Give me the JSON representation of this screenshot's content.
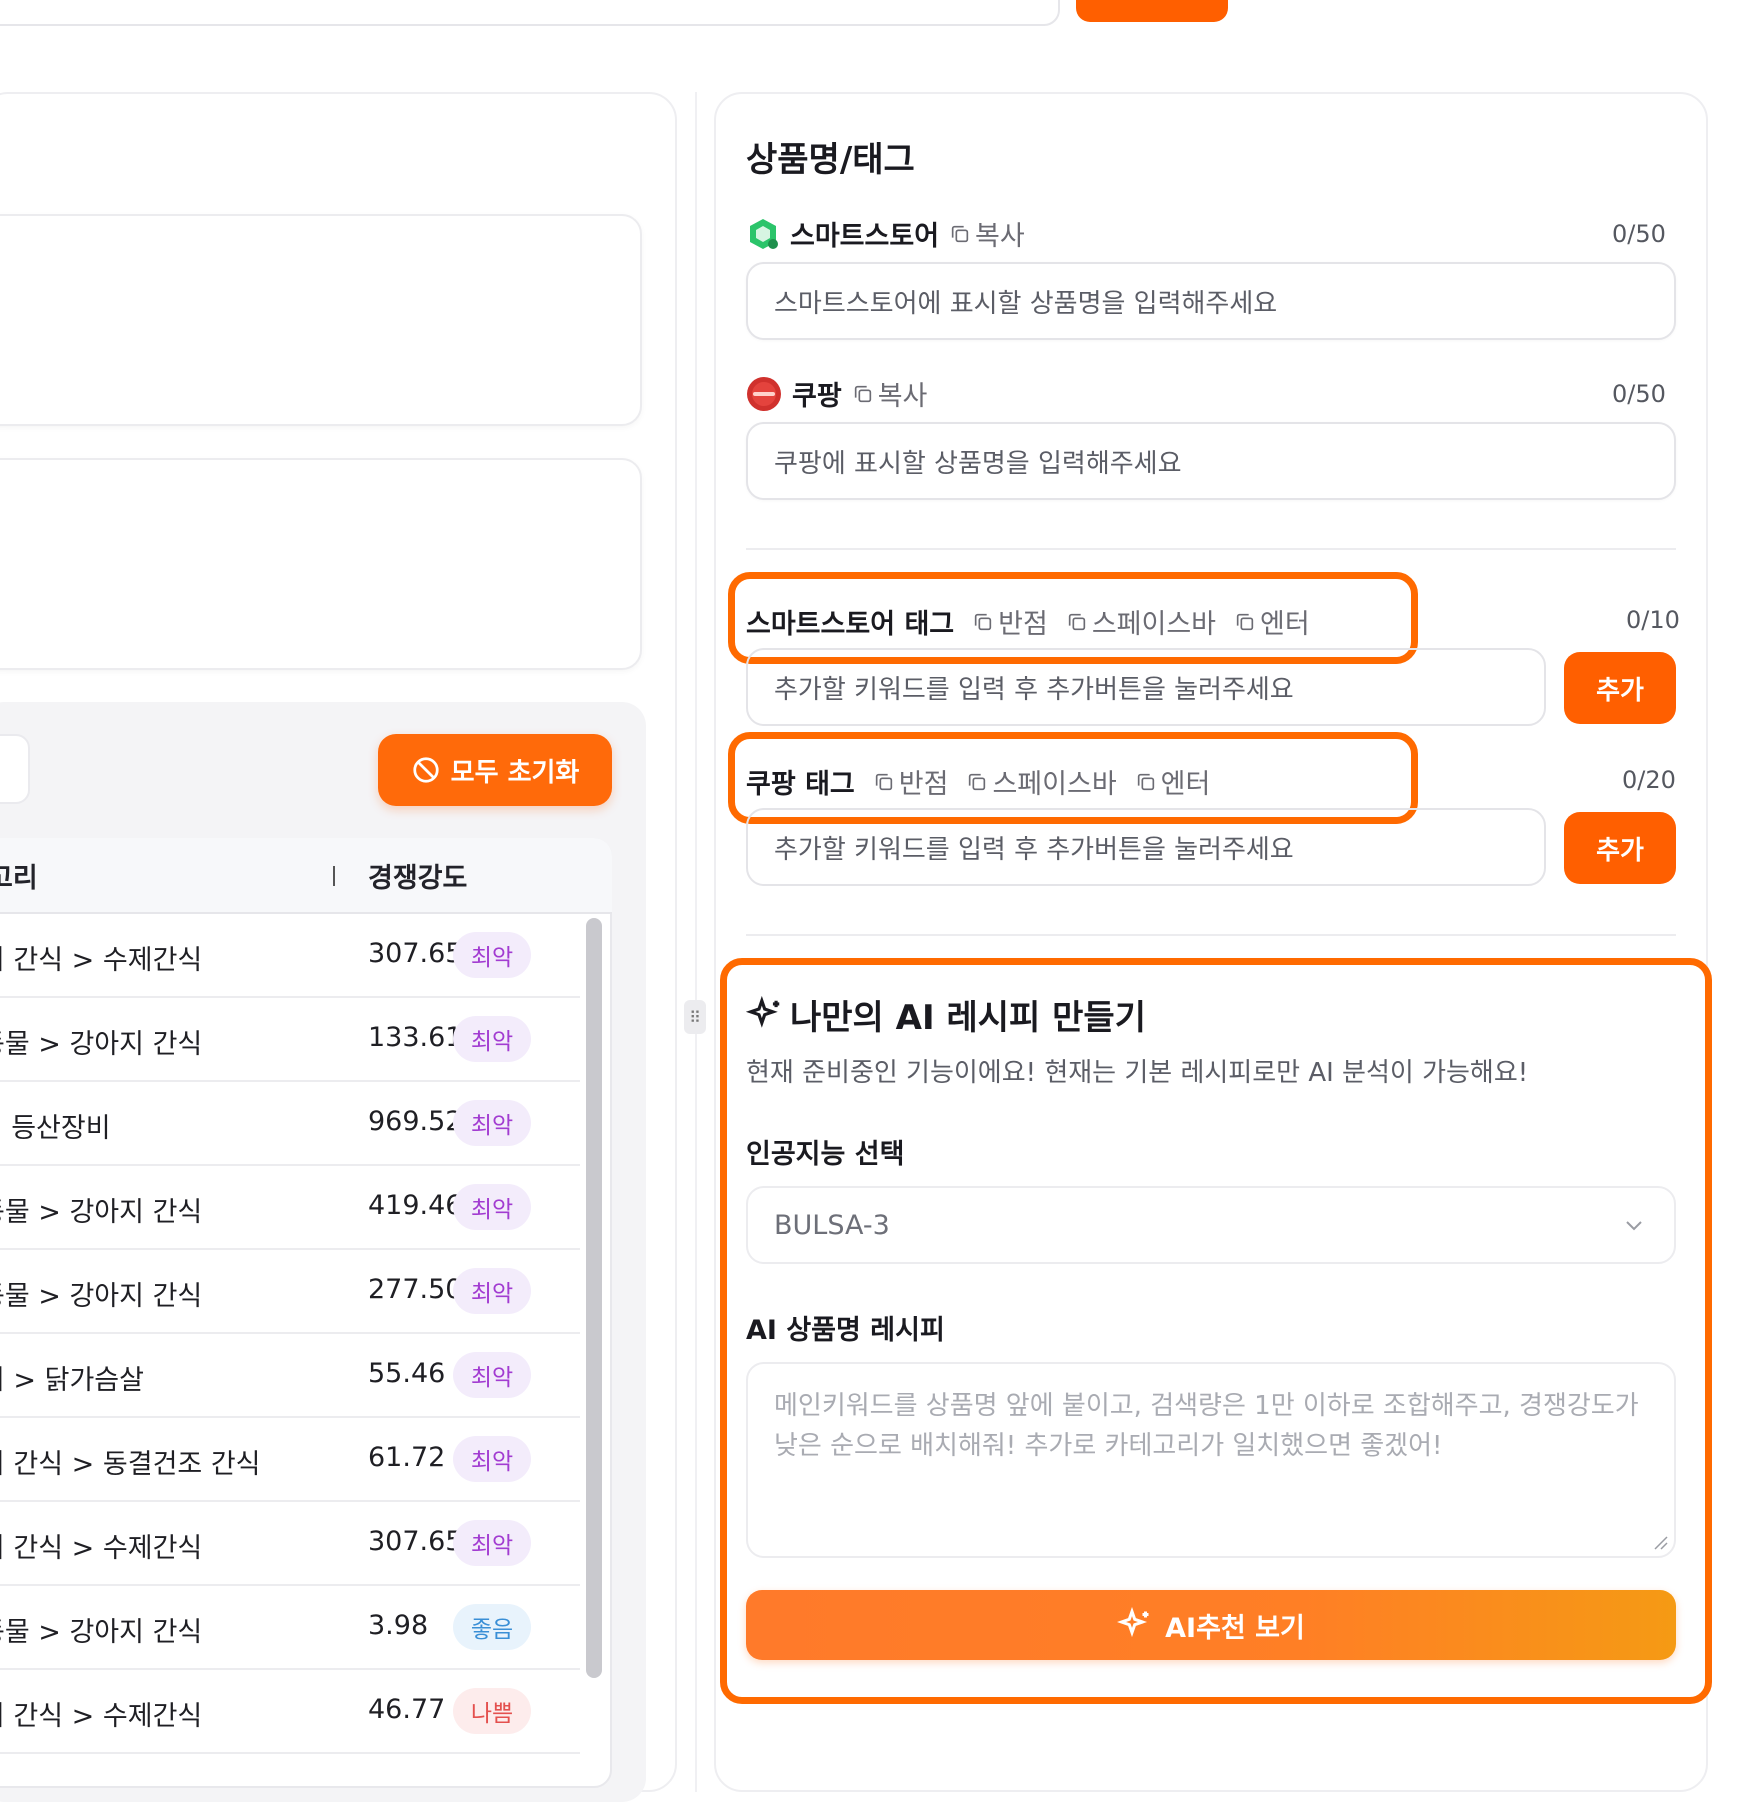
{
  "left": {
    "reset_label": "모두 초기화",
    "table": {
      "headers": {
        "category": "고리",
        "competition": "경쟁강도"
      },
      "rows": [
        {
          "category": "지 간식 > 수제간식",
          "value": "307.65",
          "badge": "최악",
          "badge_type": "bad"
        },
        {
          "category": "동물 > 강아지 간식",
          "value": "133.61",
          "badge": "최악",
          "badge_type": "bad"
        },
        {
          "category": "> 등산장비",
          "value": "969.52",
          "badge": "최악",
          "badge_type": "bad"
        },
        {
          "category": "동물 > 강아지 간식",
          "value": "419.46",
          "badge": "최악",
          "badge_type": "bad"
        },
        {
          "category": "동물 > 강아지 간식",
          "value": "277.50",
          "badge": "최악",
          "badge_type": "bad"
        },
        {
          "category": "기 > 닭가슴살",
          "value": "55.46",
          "badge": "최악",
          "badge_type": "bad"
        },
        {
          "category": "지 간식 > 동결건조 간식",
          "value": "61.72",
          "badge": "최악",
          "badge_type": "bad"
        },
        {
          "category": "지 간식 > 수제간식",
          "value": "307.65",
          "badge": "최악",
          "badge_type": "bad"
        },
        {
          "category": "동물 > 강아지 간식",
          "value": "3.98",
          "badge": "좋음",
          "badge_type": "good"
        },
        {
          "category": "지 간식 > 수제간식",
          "value": "46.77",
          "badge": "나쁨",
          "badge_type": "poor"
        }
      ]
    }
  },
  "right": {
    "section_title": "상품명/태그",
    "smartstore": {
      "name": "스마트스토어",
      "copy": "복사",
      "counter": "0/50",
      "placeholder": "스마트스토어에 표시할 상품명을 입력해주세요"
    },
    "coupang": {
      "name": "쿠팡",
      "copy": "복사",
      "counter": "0/50",
      "placeholder": "쿠팡에 표시할 상품명을 입력해주세요"
    },
    "smartstore_tags": {
      "title": "스마트스토어 태그",
      "opt_comma": "반점",
      "opt_space": "스페이스바",
      "opt_enter": "엔터",
      "counter": "0/10",
      "placeholder": "추가할 키워드를 입력 후 추가버튼을 눌러주세요",
      "add": "추가"
    },
    "coupang_tags": {
      "title": "쿠팡 태그",
      "opt_comma": "반점",
      "opt_space": "스페이스바",
      "opt_enter": "엔터",
      "counter": "0/20",
      "placeholder": "추가할 키워드를 입력 후 추가버튼을 눌러주세요",
      "add": "추가"
    },
    "ai": {
      "title": "나만의 AI 레시피 만들기",
      "subtitle": "현재 준비중인 기능이에요! 현재는 기본 레시피로만 AI 분석이 가능해요!",
      "model_label": "인공지능 선택",
      "model_value": "BULSA-3",
      "recipe_label": "AI 상품명 레시피",
      "recipe_placeholder": "메인키워드를 상품명 앞에 붙이고, 검색량은 1만 이하로 조합해주고, 경쟁강도가 낮은 순으로 배치해줘! 추가로 카테고리가 일치했으면 좋겠어!",
      "button": "AI추천 보기"
    }
  },
  "colors": {
    "accent": "#ff5f00",
    "highlight": "#ff6a00"
  }
}
